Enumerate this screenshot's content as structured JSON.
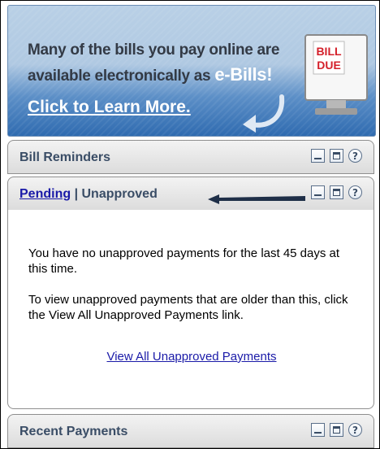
{
  "banner": {
    "line1": "Many of the bills you pay online are",
    "line2_prefix": "available electronically as ",
    "ebills": "e-Bills!",
    "link": "Click to Learn More.",
    "monitor_line1": "BILL",
    "monitor_line2": "DUE"
  },
  "bill_reminders": {
    "title": "Bill Reminders"
  },
  "pending_panel": {
    "tab_pending": "Pending",
    "separator": "|",
    "tab_unapproved": "Unapproved",
    "message1": "You have no unapproved payments for the last 45 days at this time.",
    "message2": "To view unapproved payments that are older than this, click the View All Unapproved Payments link.",
    "link": "View All Unapproved Payments"
  },
  "recent_payments": {
    "title": "Recent Payments"
  },
  "icons": {
    "minimize": "minimize-icon",
    "maximize": "maximize-icon",
    "help": "help-icon",
    "help_glyph": "?"
  },
  "colors": {
    "header_text": "#3a4d66",
    "link": "#1a1aa8",
    "banner_blue": "#2f6bb0",
    "bill_due_red": "#d4202a"
  }
}
